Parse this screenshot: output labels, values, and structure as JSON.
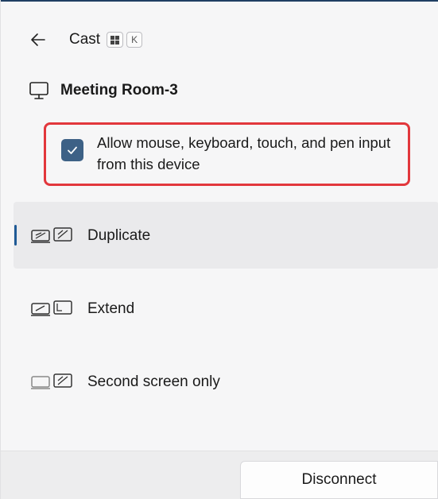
{
  "header": {
    "title": "Cast",
    "shortcut_keys": [
      "⊞",
      "K"
    ]
  },
  "device": {
    "name": "Meeting Room-3"
  },
  "input_permission": {
    "label": "Allow mouse, keyboard, touch, and pen input from this device",
    "checked": true
  },
  "modes": [
    {
      "label": "Duplicate",
      "selected": true,
      "icon": "duplicate-display-icon"
    },
    {
      "label": "Extend",
      "selected": false,
      "icon": "extend-display-icon"
    },
    {
      "label": "Second screen only",
      "selected": false,
      "icon": "second-screen-only-icon"
    }
  ],
  "footer": {
    "disconnect_label": "Disconnect"
  },
  "colors": {
    "accent": "#3d6186",
    "highlight": "#e2373c",
    "selection_bar": "#1f5a96"
  }
}
